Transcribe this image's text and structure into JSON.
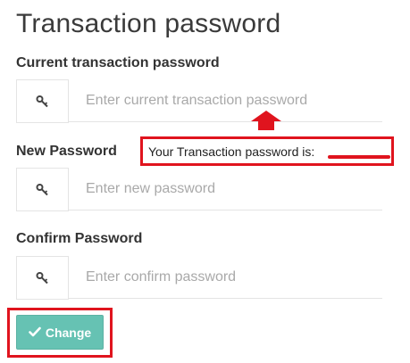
{
  "page": {
    "title": "Transaction password"
  },
  "form": {
    "current": {
      "label": "Current transaction password",
      "placeholder": "Enter current transaction password",
      "icon": "key-icon"
    },
    "new": {
      "label": "New Password",
      "placeholder": "Enter new password",
      "icon": "key-icon"
    },
    "confirm": {
      "label": "Confirm Password",
      "placeholder": "Enter confirm password",
      "icon": "key-icon"
    },
    "submit": {
      "label": "Change",
      "icon": "checkmark-icon"
    }
  },
  "annotation": {
    "note": "Your Transaction password is:",
    "color": "#e0141e"
  },
  "colors": {
    "button": "#66c2b3",
    "border": "#e4e4e4"
  }
}
